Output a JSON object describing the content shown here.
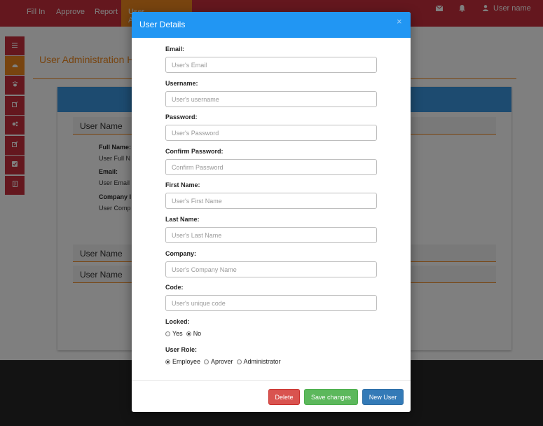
{
  "navbar": {
    "links": [
      "Fill In",
      "Approve",
      "Report"
    ],
    "active_link": "User Administration",
    "icons": [
      "envelope-icon",
      "bell-icon",
      "user-icon"
    ],
    "user_name": "User name"
  },
  "sidebar": {
    "items": [
      "menu-icon",
      "dashboard-icon",
      "paw-icon",
      "external-link-icon",
      "gears-icon",
      "edit-icon",
      "check-square-icon",
      "document-icon"
    ],
    "active_index": 1
  },
  "page": {
    "title": "User Administration Ho",
    "rows": [
      "User Name",
      "User Name",
      "User Name"
    ],
    "detail": {
      "full_name_label": "Full Name:",
      "full_name_value": "User Full N",
      "email_label": "Email:",
      "email_value": "User Email",
      "company_label": "Company I",
      "company_value": "User Comp"
    }
  },
  "modal": {
    "title": "User Details",
    "close": "×",
    "fields": [
      {
        "label": "Email:",
        "placeholder": "User's Email"
      },
      {
        "label": "Username:",
        "placeholder": "User's username"
      },
      {
        "label": "Password:",
        "placeholder": "User's Password"
      },
      {
        "label": "Confirm Password:",
        "placeholder": "Confirm Password"
      },
      {
        "label": "First Name:",
        "placeholder": "User's First Name"
      },
      {
        "label": "Last Name:",
        "placeholder": "User's Last Name"
      },
      {
        "label": "Company:",
        "placeholder": "User's Company Name"
      },
      {
        "label": "Code:",
        "placeholder": "User's unique code"
      }
    ],
    "locked": {
      "label": "Locked:",
      "options": [
        "Yes",
        "No"
      ],
      "selected": "No"
    },
    "role": {
      "label": "User Role:",
      "options": [
        "Employee",
        "Aprover",
        "Administrator"
      ],
      "selected": "Employee"
    },
    "buttons": {
      "delete": "Delete",
      "save": "Save changes",
      "new_user": "New User"
    }
  }
}
